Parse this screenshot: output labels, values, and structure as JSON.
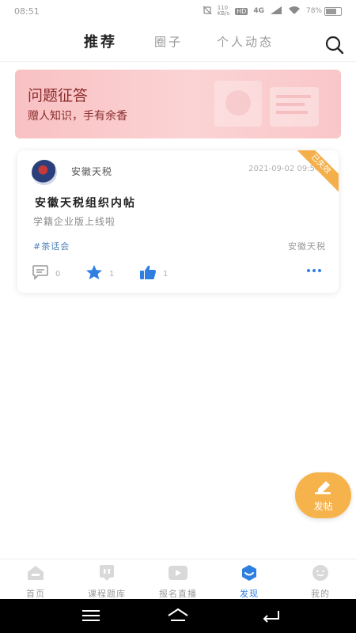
{
  "status_bar": {
    "time": "08:51",
    "net_speed": "110\nKB/s",
    "hd": "HD",
    "signal": "4G",
    "battery_level": 78,
    "battery_text": "78%"
  },
  "top_tabs": [
    {
      "label": "推荐",
      "active": true
    },
    {
      "label": "圈子",
      "active": false
    },
    {
      "label": "个人动态",
      "active": false
    }
  ],
  "search": {
    "icon": "search-icon"
  },
  "banner": {
    "title": "问题征答",
    "subtitle": "赠人知识，手有余香"
  },
  "post": {
    "author": "安徽天税",
    "timestamp": "2021-09-02 09:54:2",
    "ribbon": "已失效",
    "title": "安徽天税组织内帖",
    "body": "学籍企业版上线啦",
    "tag": "#茶话会",
    "circle": "安徽天税",
    "comments": "0",
    "favorites": "1",
    "likes": "1"
  },
  "fab": {
    "label": "发帖"
  },
  "bottom_nav": [
    {
      "label": "首页",
      "icon": "home-icon",
      "active": false
    },
    {
      "label": "课程题库",
      "icon": "question-bank-icon",
      "active": false
    },
    {
      "label": "报名直播",
      "icon": "live-play-icon",
      "active": false
    },
    {
      "label": "发现",
      "icon": "discover-icon",
      "active": true
    },
    {
      "label": "我的",
      "icon": "profile-icon",
      "active": false
    }
  ],
  "colors": {
    "accent_blue": "#2f7fe3",
    "fab_orange": "#f6b34c",
    "banner_text": "#8b2b2b",
    "banner_bg": "#fbd3d4",
    "ribbon": "#f3b04a"
  }
}
